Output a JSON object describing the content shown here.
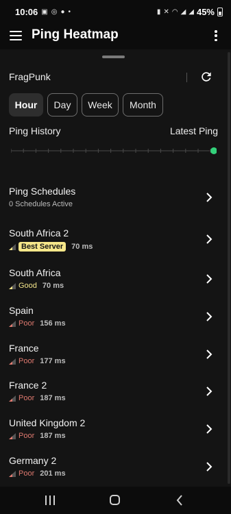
{
  "status_bar": {
    "time": "10:06",
    "battery": "45%"
  },
  "app_bar": {
    "title": "Ping Heatmap"
  },
  "header": {
    "game": "FragPunk"
  },
  "range_tabs": [
    {
      "label": "Hour",
      "active": true
    },
    {
      "label": "Day",
      "active": false
    },
    {
      "label": "Week",
      "active": false
    },
    {
      "label": "Month",
      "active": false
    }
  ],
  "history": {
    "left_label": "Ping History",
    "right_label": "Latest Ping",
    "latest_dot_color": "#33d17a"
  },
  "schedules": {
    "title": "Ping Schedules",
    "subtitle": "0 Schedules Active"
  },
  "servers": [
    {
      "name": "South Africa 2",
      "quality": "Best Server",
      "quality_kind": "best",
      "ping": "70 ms"
    },
    {
      "name": "South Africa",
      "quality": "Good",
      "quality_kind": "good",
      "ping": "70 ms"
    },
    {
      "name": "Spain",
      "quality": "Poor",
      "quality_kind": "poor",
      "ping": "156 ms"
    },
    {
      "name": "France",
      "quality": "Poor",
      "quality_kind": "poor",
      "ping": "177 ms"
    },
    {
      "name": "France 2",
      "quality": "Poor",
      "quality_kind": "poor",
      "ping": "187 ms"
    },
    {
      "name": "United Kingdom 2",
      "quality": "Poor",
      "quality_kind": "poor",
      "ping": "187 ms"
    },
    {
      "name": "Germany 2",
      "quality": "Poor",
      "quality_kind": "poor",
      "ping": "201 ms"
    }
  ],
  "colors": {
    "best": "#f6e78a",
    "good": "#f3e48a",
    "poor": "#e07a70"
  },
  "icons": {
    "menu": "menu-icon",
    "overflow": "more-vert-icon",
    "refresh": "refresh-icon",
    "chevron": "chevron-right-icon",
    "signal": "signal-strength-icon",
    "nav_recent": "recent-apps-icon",
    "nav_home": "home-icon",
    "nav_back": "back-icon"
  }
}
